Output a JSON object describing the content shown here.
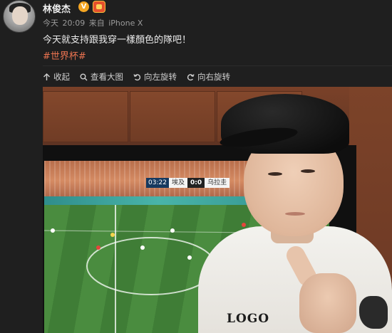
{
  "post": {
    "username": "林俊杰",
    "verified_mark": "V",
    "meta": {
      "date": "今天",
      "time": "20:09",
      "source_prefix": "来自",
      "device": "iPhone X"
    },
    "text": "今天就支持跟我穿一樣顏色的隊吧！",
    "hashtag": "#世界杯#"
  },
  "toolbar": {
    "collapse_label": "收起",
    "view_large_label": "查看大图",
    "rotate_left_label": "向左旋转",
    "rotate_right_label": "向右旋转"
  },
  "photo": {
    "scoreboard": {
      "time": "03:22",
      "team_left": "埃及",
      "score": "0:0",
      "team_right": "乌拉圭"
    },
    "shirt_text": "LOGO"
  },
  "icons": {
    "collapse": "arrow-up-icon",
    "view_large": "magnifier-icon",
    "rotate_left": "rotate-left-icon",
    "rotate_right": "rotate-right-icon",
    "verified": "verified-badge-icon",
    "member": "member-badge-icon"
  },
  "colors": {
    "background": "#1f1f1f",
    "hashtag": "#eb7350",
    "verified": "#f5a623",
    "meta_text": "#9b9b9b"
  }
}
